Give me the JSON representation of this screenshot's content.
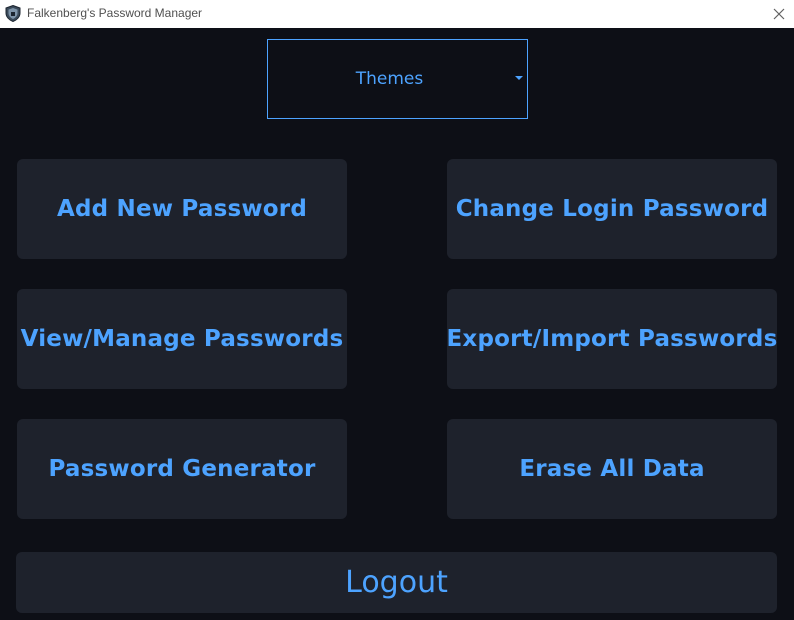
{
  "window": {
    "title": "Falkenberg's Password Manager"
  },
  "themes": {
    "selected": "Themes"
  },
  "menu": {
    "add_new_password": "Add New Password",
    "change_login_password": "Change Login Password",
    "view_manage_passwords": "View/Manage Passwords",
    "export_import_passwords": "Export/Import Passwords",
    "password_generator": "Password Generator",
    "erase_all_data": "Erase All Data"
  },
  "logout": {
    "label": "Logout"
  },
  "colors": {
    "background": "#0d0f16",
    "button": "#1e222c",
    "accent": "#4da3ff"
  },
  "icons": {
    "app": "shield-icon",
    "close": "close-icon",
    "dropdown": "caret-down-icon"
  }
}
